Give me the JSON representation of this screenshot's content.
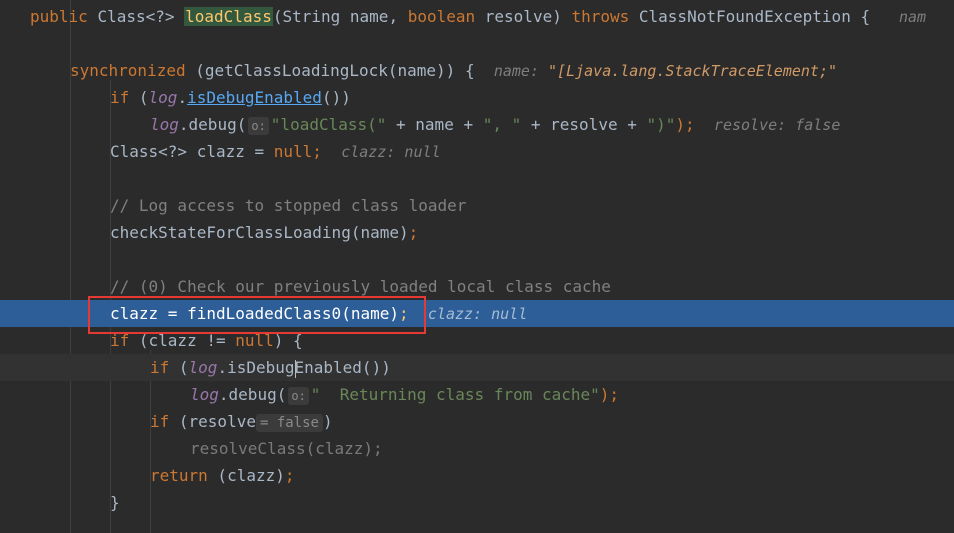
{
  "editor": {
    "line1": {
      "kw_public": "public",
      "type": "Class<?>",
      "method": "loadClass",
      "params_open": "(String name, ",
      "kw_boolean": "boolean",
      "params_close": " resolve) ",
      "kw_throws": "throws",
      "exception": " ClassNotFoundException {",
      "hint": "nam"
    },
    "line2": {
      "kw": "synchronized",
      "code": " (getClassLoadingLock(name)) {",
      "hint_label": "name: ",
      "hint_value": "\"[Ljava.lang.StackTraceElement;\""
    },
    "line3": {
      "kw_if": "if",
      "open": " (",
      "field": "log",
      "dot": ".",
      "call": "isDebugEnabled",
      "close": "())"
    },
    "line4": {
      "field": "log",
      "call": ".debug(",
      "badge": "o:",
      "str1": "\"loadClass(\"",
      "mid1": " + name + ",
      "str2": "\", \"",
      "mid2": " + resolve + ",
      "str3": "\")\"",
      "end": ");",
      "hint": "resolve: false"
    },
    "line5": {
      "code": "Class<?> clazz = ",
      "kw_null": "null",
      "semi": ";",
      "hint": "clazz: null"
    },
    "line6": {
      "comment": "// Log access to stopped class loader"
    },
    "line7": {
      "code": "checkStateForClassLoading(name)",
      "semi": ";"
    },
    "line8": {
      "comment": "// (0) Check our previously loaded local class cache"
    },
    "line9": {
      "code": "clazz = findLoadedClass0(name)",
      "semi": ";",
      "hint": "clazz: null"
    },
    "line10": {
      "kw_if": "if",
      "code_a": " (clazz != ",
      "kw_null": "null",
      "code_b": ") {"
    },
    "line11": {
      "kw_if": "if",
      "open": " (",
      "field": "log",
      "call_a": ".isDebug",
      "call_b": "Enabled())"
    },
    "line12": {
      "field": "log",
      "call": ".debug(",
      "badge": "o:",
      "str": "\"  Returning class from cache\"",
      "end": ");"
    },
    "line13": {
      "kw_if": "if",
      "code_a": " (resolve",
      "inline_value": "= false",
      "code_b": ")"
    },
    "line14": {
      "code": "resolveClass(clazz);"
    },
    "line15": {
      "kw_return": "return",
      "code": " (clazz)",
      "semi": ";"
    },
    "line16": {
      "code": "}"
    }
  }
}
